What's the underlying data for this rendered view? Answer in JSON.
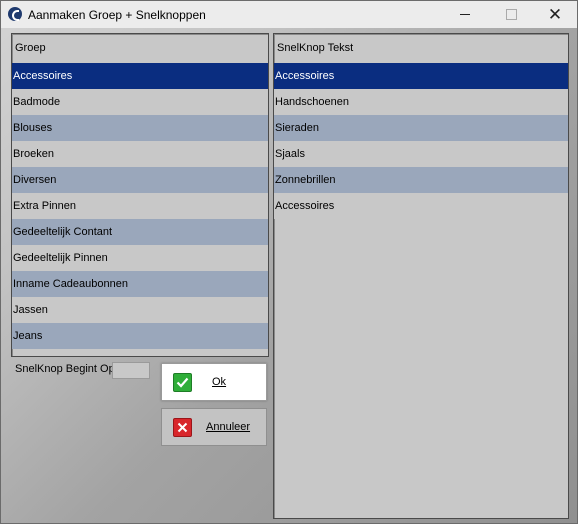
{
  "window": {
    "title": "Aanmaken Groep + Snelknoppen"
  },
  "left_list": {
    "header": "Groep",
    "items": [
      "Accessoires",
      "Badmode",
      "Blouses",
      "Broeken",
      "Diversen",
      "Extra Pinnen",
      "Gedeeltelijk Contant",
      "Gedeeltelijk Pinnen",
      "Inname Cadeaubonnen",
      "Jassen",
      "Jeans"
    ],
    "selected_index": 0
  },
  "right_list": {
    "header": "SnelKnop Tekst",
    "items": [
      "Accessoires",
      "Handschoenen",
      "Sieraden",
      "Sjaals",
      "Zonnebrillen",
      "Accessoires"
    ],
    "selected_index": 0
  },
  "start_field": {
    "label": "SnelKnop Begint Op",
    "value": ""
  },
  "buttons": {
    "ok_label": "Ok",
    "cancel_label": "Annuleer"
  },
  "colors": {
    "selected_row": "#0a2d80",
    "alt_row": "#9aa7bb",
    "ok_icon": "#2fae39",
    "cancel_icon": "#d8262b"
  }
}
